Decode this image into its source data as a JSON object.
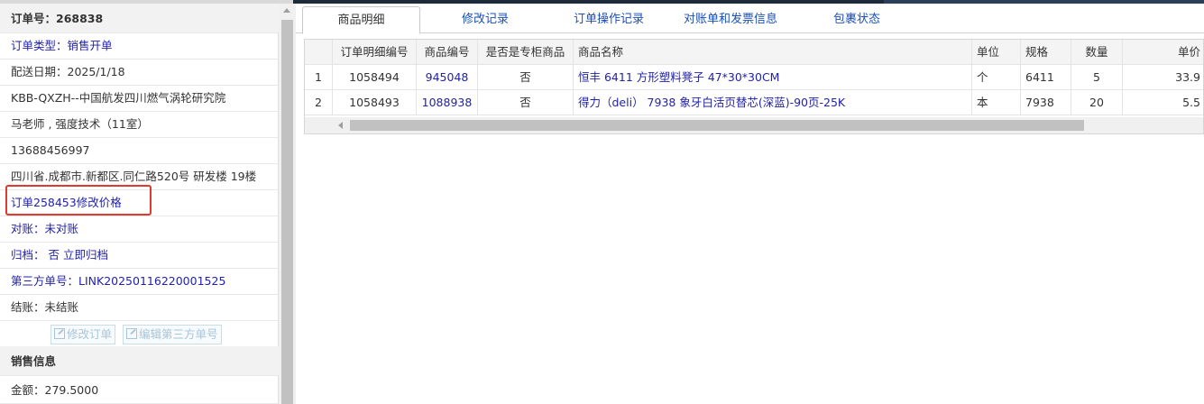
{
  "order": {
    "title": "订单号：268838",
    "type": "订单类型：销售开单",
    "delivery_date": "配送日期：2025/1/18",
    "customer": "KBB-QXZH--中国航发四川燃气涡轮研究院",
    "contact": "马老师 , 强度技术（11室）",
    "phone": "13688456997",
    "address": "四川省.成都市.新都区.同仁路520号 研发楼 19楼",
    "modify_price": "订单258453修改价格",
    "reconcile": "对账：未对账",
    "archive": "归档：  否 立即归档",
    "third_party": "第三方单号：LINK20250116220001525",
    "settlement": "结账：未结账"
  },
  "buttons": {
    "edit_order": "修改订单",
    "edit_third_party": "编辑第三方单号"
  },
  "sales": {
    "header": "销售信息",
    "amount": "金额：279.5000"
  },
  "tabs": [
    "商品明细",
    "修改记录",
    "订单操作记录",
    "对账单和发票信息",
    "包裹状态"
  ],
  "table": {
    "columns": [
      "",
      "订单明细编号",
      "商品编号",
      "是否是专柜商品",
      "商品名称",
      "单位",
      "规格",
      "数量",
      "单价"
    ],
    "rows": [
      [
        "1",
        "1058494",
        "945048",
        "否",
        "恒丰 6411 方形塑料凳子 47*30*30CM",
        "个",
        "6411",
        "5",
        "33.9"
      ],
      [
        "2",
        "1058493",
        "1088938",
        "否",
        "得力（deli） 7938 象牙白活页替芯(深蓝)-90页-25K",
        "本",
        "7938",
        "20",
        "5.5"
      ]
    ]
  },
  "colors": {
    "link": "#2222aa",
    "highlight_box": "#e03a2f",
    "topbar": "#1c2a3a"
  }
}
